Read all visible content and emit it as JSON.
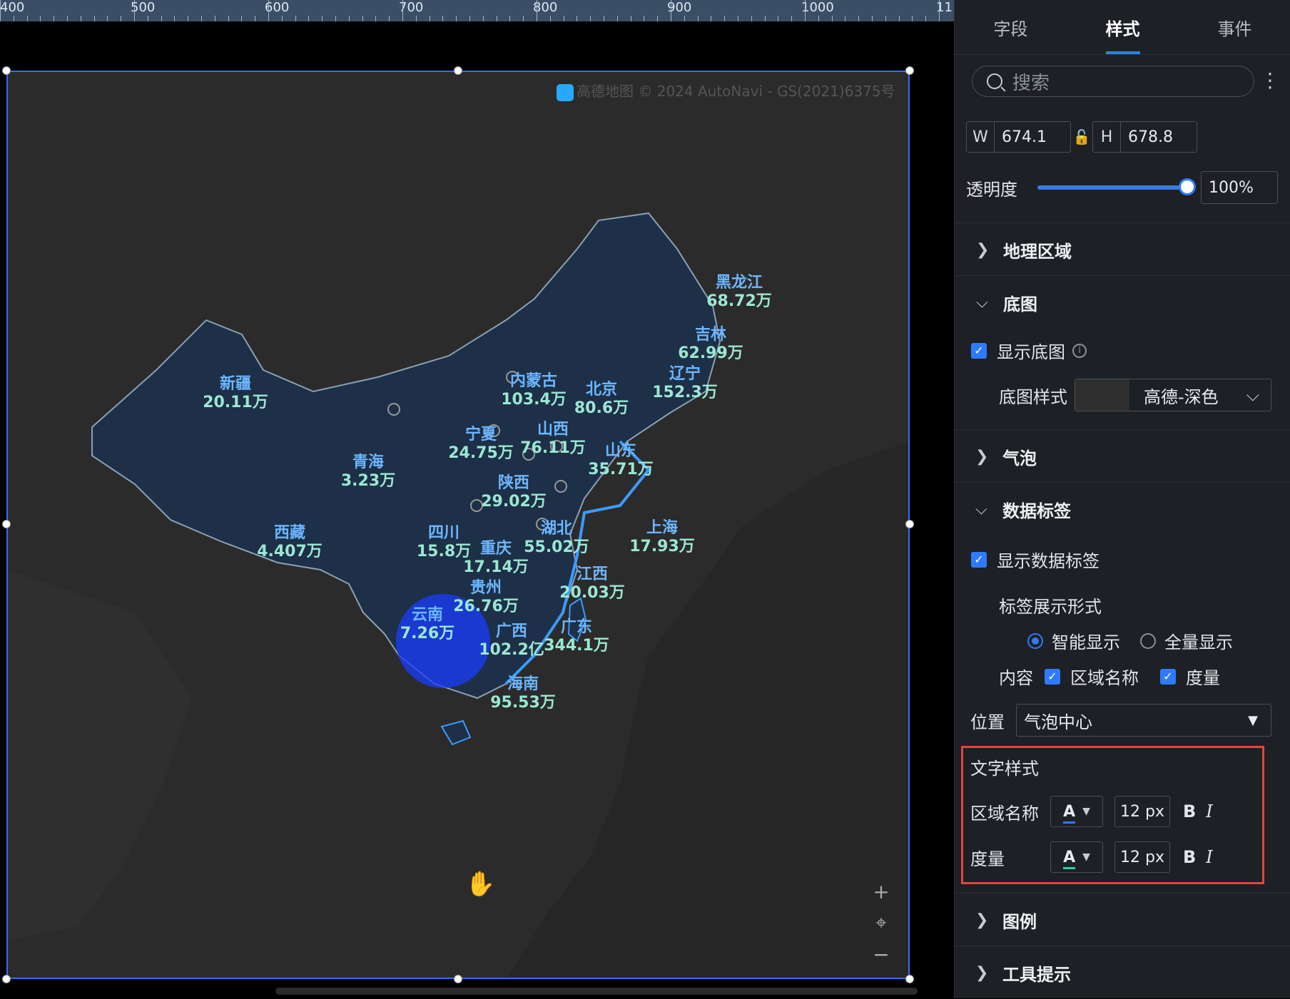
{
  "ruler": {
    "labels": [
      "400",
      "500",
      "600",
      "700",
      "800",
      "900",
      "1000",
      "11"
    ]
  },
  "map": {
    "attribution": "高德地图 © 2024 AutoNavi - GS(2021)6375号",
    "labels": [
      {
        "name": "黑龙江",
        "value": "68.72万"
      },
      {
        "name": "吉林",
        "value": "62.99万"
      },
      {
        "name": "辽宁",
        "value": "152.3万"
      },
      {
        "name": "北京",
        "value": "80.6万"
      },
      {
        "name": "内蒙古",
        "value": "103.4万"
      },
      {
        "name": "新疆",
        "value": "20.11万"
      },
      {
        "name": "宁夏",
        "value": "24.75万"
      },
      {
        "name": "山西",
        "value": "76.11万"
      },
      {
        "name": "山东",
        "value": "35.71万"
      },
      {
        "name": "青海",
        "value": "3.23万"
      },
      {
        "name": "陕西",
        "value": "29.02万"
      },
      {
        "name": "西藏",
        "value": "4.407万"
      },
      {
        "name": "四川",
        "value": "15.8万"
      },
      {
        "name": "湖北",
        "value": "55.02万"
      },
      {
        "name": "上海",
        "value": "17.93万"
      },
      {
        "name": "重庆",
        "value": "17.14万"
      },
      {
        "name": "江西",
        "value": "20.03万"
      },
      {
        "name": "贵州",
        "value": "26.76万"
      },
      {
        "name": "云南",
        "value": "7.26万"
      },
      {
        "name": "广西",
        "value": "102.2亿"
      },
      {
        "name": "广东",
        "value": "344.1万"
      },
      {
        "name": "海南",
        "value": "95.53万"
      }
    ]
  },
  "panel": {
    "tabs": [
      "字段",
      "样式",
      "事件"
    ],
    "active_tab": "样式",
    "search_placeholder": "搜索",
    "width_label": "W",
    "width_value": "674.1",
    "height_label": "H",
    "height_value": "678.8",
    "opacity_label": "透明度",
    "opacity_value": "100%",
    "opacity_level": 1.0,
    "sections": {
      "geo": "地理区域",
      "basemap": "底图",
      "bubble": "气泡",
      "datalabel": "数据标签",
      "legend": "图例",
      "tooltip": "工具提示"
    },
    "show_basemap": "显示底图",
    "basemap_style_label": "底图样式",
    "basemap_style_value": "高德-深色",
    "show_datalabel": "显示数据标签",
    "label_mode_title": "标签展示形式",
    "label_mode_smart": "智能显示",
    "label_mode_all": "全量显示",
    "content_label": "内容",
    "content_region": "区域名称",
    "content_measure": "度量",
    "position_label": "位置",
    "position_value": "气泡中心",
    "text_style_title": "文字样式",
    "region_name_label": "区域名称",
    "measure_label": "度量",
    "color_glyph": "A",
    "region_font_size": "12 px",
    "measure_font_size": "12 px",
    "bold_glyph": "B",
    "italic_glyph": "I",
    "colors": {
      "accent": "#2f7bff",
      "highlight_box": "#e0463e",
      "label_name": "#6db6ff",
      "label_value": "#9be7d3"
    }
  }
}
